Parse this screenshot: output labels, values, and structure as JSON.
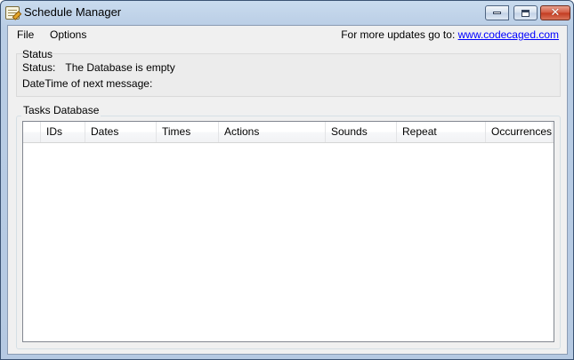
{
  "window": {
    "title": "Schedule Manager"
  },
  "menu": {
    "file": "File",
    "options": "Options"
  },
  "updates": {
    "prefix": "For more updates go to: ",
    "link_text": "www.codecaged.com"
  },
  "status": {
    "group_title": "Status",
    "status_label": "Status:",
    "status_value": "The Database is empty",
    "next_message_label": "DateTime of next message:",
    "next_message_value": ""
  },
  "tasks": {
    "group_title": "Tasks Database",
    "columns": [
      "",
      "IDs",
      "Dates",
      "Times",
      "Actions",
      "Sounds",
      "Repeat",
      "Occurrences"
    ],
    "rows": []
  }
}
